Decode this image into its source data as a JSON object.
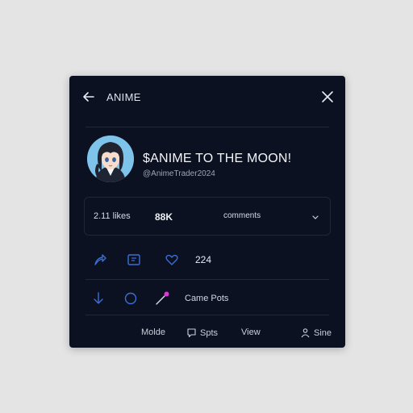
{
  "header": {
    "title": "ANIME"
  },
  "profile": {
    "name": "$ANIME TO THE MOON!",
    "handle": "@AnimeTrader2024"
  },
  "stats": {
    "likes": "2.11 likes",
    "views": "88K",
    "comments": "comments"
  },
  "actions": {
    "count": "224",
    "action_label": "Came Pots"
  },
  "footer": {
    "more": "Molde",
    "spots": "Spts",
    "view": "View",
    "share": "Sine"
  },
  "colors": {
    "card_bg": "#0b1120",
    "page_bg": "#e4e4e4",
    "icon_blue": "#3b6fd6",
    "accent_pink": "#d63ad8"
  },
  "icons": [
    "back-arrow-icon",
    "close-icon",
    "chevron-down-icon",
    "share-icon",
    "repost-icon",
    "heart-icon",
    "download-icon",
    "circle-icon",
    "pin-icon",
    "comment-icon",
    "user-icon"
  ]
}
